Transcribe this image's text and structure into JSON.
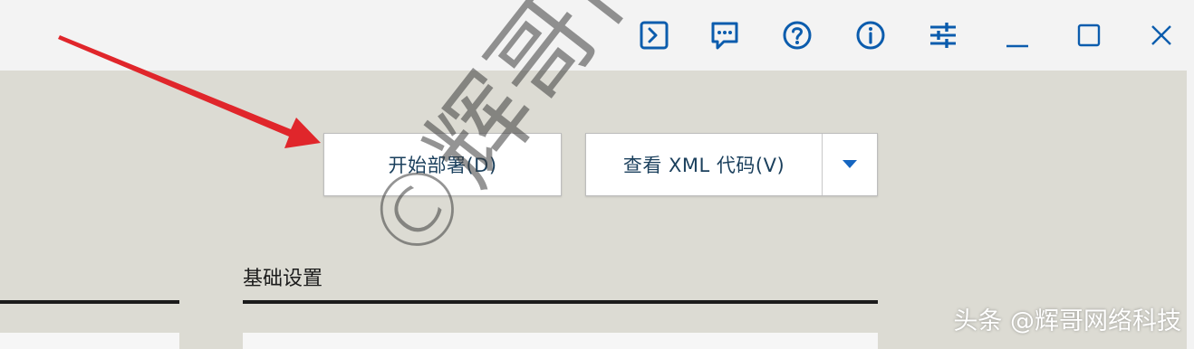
{
  "titlebar": {
    "buttons": [
      {
        "icon": "terminal-icon"
      },
      {
        "icon": "feedback-icon"
      },
      {
        "icon": "help-icon"
      },
      {
        "icon": "info-icon"
      },
      {
        "icon": "settings-sliders-icon"
      },
      {
        "icon": "minimize-icon"
      },
      {
        "icon": "maximize-icon"
      },
      {
        "icon": "close-icon"
      }
    ]
  },
  "actions": {
    "deploy_label": "开始部署(D)",
    "view_xml_label": "查看 XML 代码(V)",
    "dropdown_icon": "caret-down-icon"
  },
  "section": {
    "title": "基础设置"
  },
  "overlay": {
    "watermark": "©辉哥博客",
    "credit": "头条 @辉哥网络科技",
    "arrow_color": "#e0262b"
  },
  "colors": {
    "accent": "#1565c0",
    "button_text": "#1a3f5c",
    "background": "#dcdbd3"
  }
}
